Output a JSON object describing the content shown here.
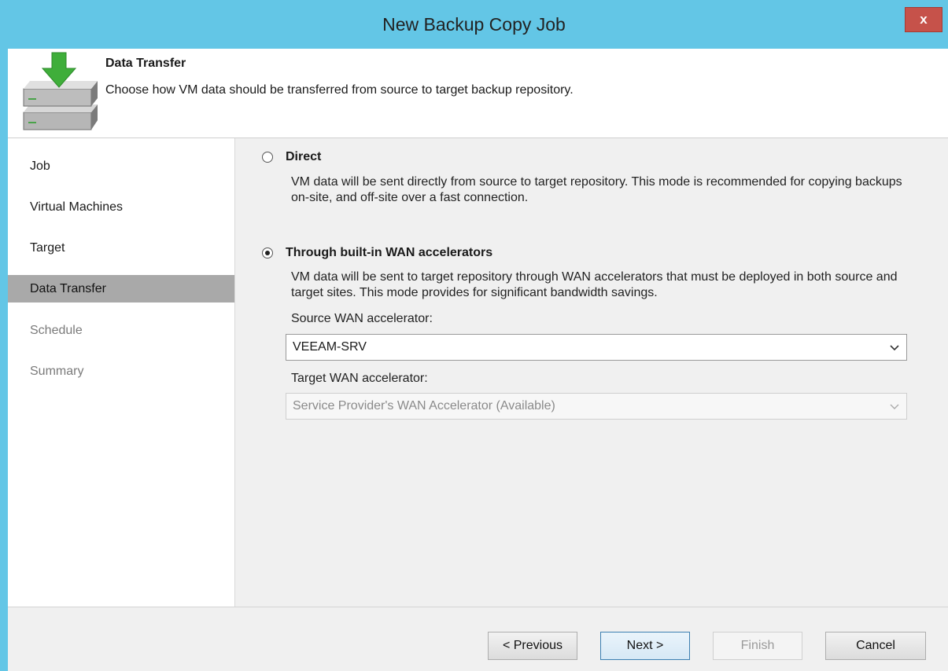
{
  "window": {
    "title": "New Backup Copy Job",
    "close_label": "x"
  },
  "header": {
    "title": "Data Transfer",
    "description": "Choose how VM data should be transferred from source to target backup repository."
  },
  "sidebar": {
    "items": [
      {
        "label": "Job",
        "state": "normal"
      },
      {
        "label": "Virtual Machines",
        "state": "normal"
      },
      {
        "label": "Target",
        "state": "normal"
      },
      {
        "label": "Data Transfer",
        "state": "active"
      },
      {
        "label": "Schedule",
        "state": "disabled"
      },
      {
        "label": "Summary",
        "state": "disabled"
      }
    ]
  },
  "options": {
    "direct": {
      "label": "Direct",
      "selected": false,
      "description": "VM data will be sent directly from source to target repository. This mode is recommended for copying backups on-site, and off-site over a fast connection."
    },
    "wan": {
      "label": "Through built-in WAN accelerators",
      "selected": true,
      "description": "VM data will be sent to target repository through WAN accelerators that must be deployed in both source and target sites. This mode provides for significant bandwidth savings."
    }
  },
  "source_wan": {
    "label": "Source WAN accelerator:",
    "value": "VEEAM-SRV"
  },
  "target_wan": {
    "label": "Target WAN accelerator:",
    "value": "Service Provider's WAN Accelerator (Available)"
  },
  "footer": {
    "previous_label": "< Previous",
    "next_label": "Next >",
    "finish_label": "Finish",
    "cancel_label": "Cancel"
  },
  "colors": {
    "titlebar": "#63c6e6",
    "close_button": "#c6524a",
    "active_nav": "#a9a9a9"
  }
}
